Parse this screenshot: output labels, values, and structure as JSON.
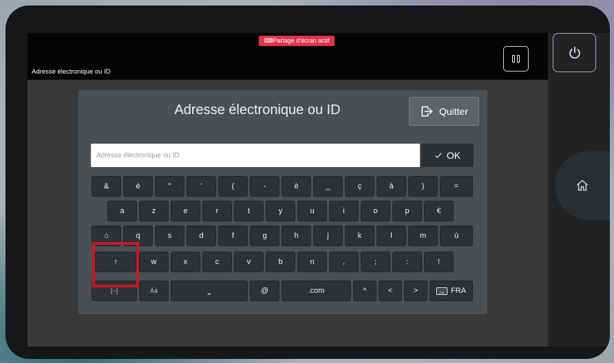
{
  "share_badge": "⌨Partage d'écran actif",
  "page_title": "Adresse électronique ou ID",
  "dialog": {
    "title": "Adresse électronique ou ID",
    "quit_label": "Quitter",
    "input_placeholder": "Adresse électronique ou ID",
    "input_value": "",
    "ok_label": "OK"
  },
  "keyboard": {
    "row1": [
      "&",
      "é",
      "\"",
      "'",
      "(",
      "-",
      "è",
      "_",
      "ç",
      "à",
      ")",
      "="
    ],
    "row2": [
      "a",
      "z",
      "e",
      "r",
      "t",
      "y",
      "u",
      "i",
      "o",
      "p",
      "€"
    ],
    "row3_shift": "⌂",
    "row3": [
      "q",
      "s",
      "d",
      "f",
      "g",
      "h",
      "j",
      "k",
      "l",
      "m",
      "ù"
    ],
    "row4_shift": "↑",
    "row4": [
      "w",
      "x",
      "c",
      "v",
      "b",
      "n",
      ",",
      ";",
      ":",
      "!"
    ],
    "row5": {
      "symbols": "[~]",
      "accents": "Áá",
      "space": "⎵",
      "at": "@",
      "dotcom": ".com",
      "caret": "^",
      "left": "<",
      "right": ">",
      "language": "FRA"
    }
  },
  "icons": {
    "pause": "pause-icon",
    "power": "power-icon",
    "home": "home-icon",
    "quit": "exit-icon",
    "ok": "check-icon",
    "keyboard": "keyboard-icon"
  },
  "colors": {
    "badge": "#e1344a",
    "highlight": "#c8182a",
    "dialog": "#4c4f52",
    "key": "#2f3235"
  }
}
